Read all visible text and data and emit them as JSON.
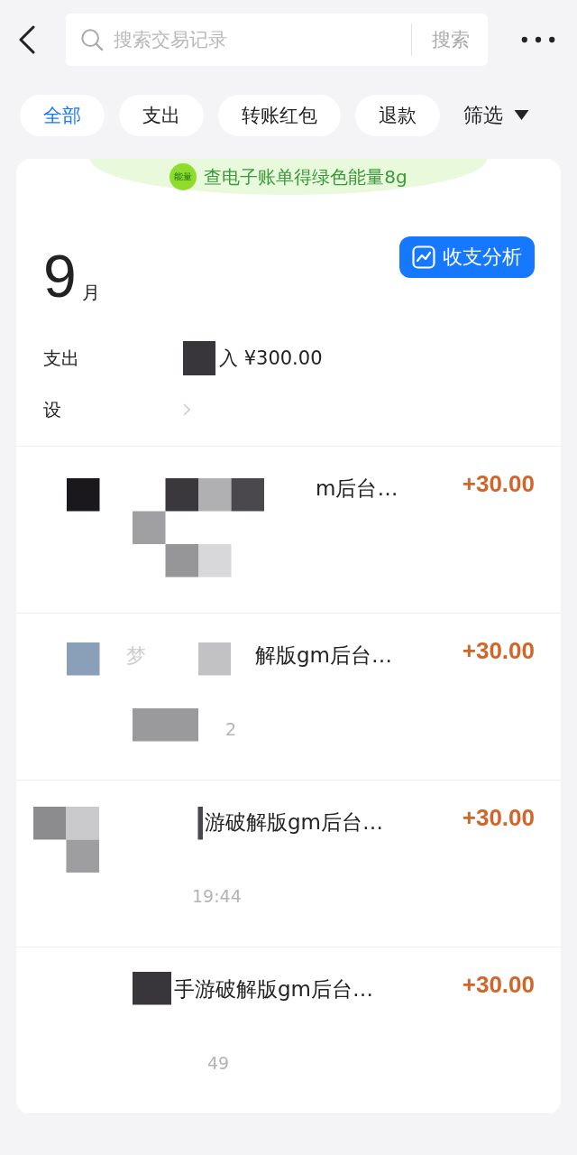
{
  "search": {
    "placeholder": "搜索交易记录",
    "button": "搜索"
  },
  "tabs": [
    {
      "label": "全部",
      "selected": true
    },
    {
      "label": "支出",
      "selected": false
    },
    {
      "label": "转账红包",
      "selected": false
    },
    {
      "label": "退款",
      "selected": false
    }
  ],
  "filter": {
    "label": "筛选"
  },
  "banner": {
    "badge": "能量",
    "text": "查电子账单得绿色能量8g"
  },
  "month": {
    "number": "9",
    "unit": "月"
  },
  "analysis_button": "收支分析",
  "summary": {
    "expense_label": "支出",
    "income": "入 ¥300.00",
    "settings_label": "设"
  },
  "transactions": [
    {
      "title": "m后台…",
      "amount": "+30.00"
    },
    {
      "lead": "梦",
      "title": "解版gm后台…",
      "amount": "+30.00",
      "time": "2"
    },
    {
      "title": "游破解版gm后台…",
      "amount": "+30.00",
      "time": "19:44"
    },
    {
      "title": "手游破解版gm后台…",
      "amount": "+30.00",
      "time": "49"
    }
  ]
}
